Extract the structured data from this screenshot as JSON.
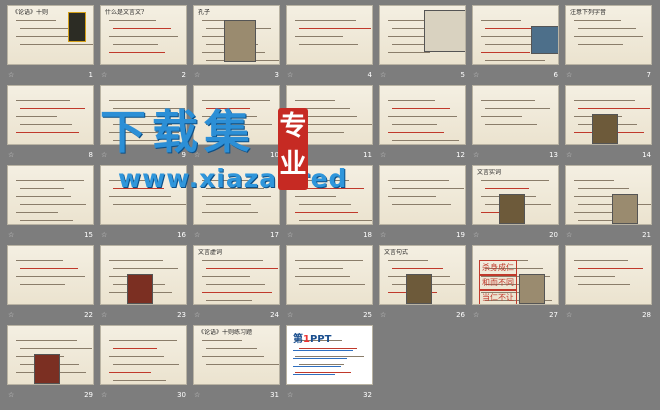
{
  "slides": [
    {
      "num": "1",
      "title": "《论语》十则"
    },
    {
      "num": "2",
      "title": "什么是文言文?"
    },
    {
      "num": "3",
      "title": "孔子"
    },
    {
      "num": "4",
      "title": ""
    },
    {
      "num": "5",
      "title": ""
    },
    {
      "num": "6",
      "title": ""
    },
    {
      "num": "7",
      "title": "注意下列字音"
    },
    {
      "num": "8",
      "title": ""
    },
    {
      "num": "9",
      "title": ""
    },
    {
      "num": "10",
      "title": ""
    },
    {
      "num": "11",
      "title": ""
    },
    {
      "num": "12",
      "title": ""
    },
    {
      "num": "13",
      "title": ""
    },
    {
      "num": "14",
      "title": ""
    },
    {
      "num": "15",
      "title": ""
    },
    {
      "num": "16",
      "title": ""
    },
    {
      "num": "17",
      "title": ""
    },
    {
      "num": "18",
      "title": ""
    },
    {
      "num": "19",
      "title": ""
    },
    {
      "num": "20",
      "title": "文言实词"
    },
    {
      "num": "21",
      "title": ""
    },
    {
      "num": "22",
      "title": ""
    },
    {
      "num": "23",
      "title": ""
    },
    {
      "num": "24",
      "title": "文言虚词"
    },
    {
      "num": "25",
      "title": ""
    },
    {
      "num": "26",
      "title": "文言句式"
    },
    {
      "num": "27",
      "title": ""
    },
    {
      "num": "28",
      "title": ""
    },
    {
      "num": "29",
      "title": ""
    },
    {
      "num": "30",
      "title": ""
    },
    {
      "num": "31",
      "title": "《论语》十则练习题"
    },
    {
      "num": "32",
      "title": ""
    }
  ],
  "watermark": {
    "big_text": "下载集",
    "url_text": "www.xiazai.red",
    "seal_text": "专业"
  },
  "slide27": {
    "items": [
      "杀身成仁",
      "和而不同",
      "当仁不让"
    ]
  },
  "slide32": {
    "logo_main": "第",
    "logo_accent": "1",
    "logo_rest": "PPT"
  }
}
